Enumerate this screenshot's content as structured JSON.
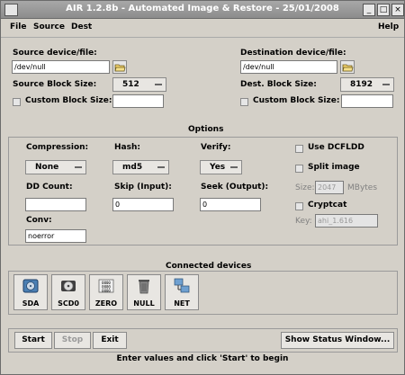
{
  "window": {
    "title": "AIR 1.2.8b - Automated Image & Restore - 25/01/2008"
  },
  "menu": {
    "file": "File",
    "source": "Source",
    "dest": "Dest",
    "help": "Help"
  },
  "source": {
    "label": "Source device/file:",
    "path": "/dev/null",
    "block_size_label": "Source Block Size:",
    "block_size": "512",
    "custom_label": "Custom Block Size:"
  },
  "dest": {
    "label": "Destination device/file:",
    "path": "/dev/null",
    "block_size_label": "Dest. Block Size:",
    "block_size": "8192",
    "custom_label": "Custom Block Size:"
  },
  "options": {
    "title": "Options",
    "compression_label": "Compression:",
    "compression": "None",
    "hash_label": "Hash:",
    "hash": "md5",
    "verify_label": "Verify:",
    "verify": "Yes",
    "use_dcfldd": "Use DCFLDD",
    "split_image": "Split image",
    "size_label": "Size:",
    "size_value": "2047",
    "size_unit": "MBytes",
    "cryptcat": "Cryptcat",
    "key_label": "Key:",
    "key_value": "ahi_1.616",
    "dd_count_label": "DD Count:",
    "dd_count": "",
    "skip_label": "Skip (Input):",
    "skip": "0",
    "seek_label": "Seek (Output):",
    "seek": "0",
    "conv_label": "Conv:",
    "conv": "noerror"
  },
  "devices": {
    "title": "Connected devices",
    "items": [
      {
        "label": "SDA",
        "icon": "hard-disk-icon"
      },
      {
        "label": "SCD0",
        "icon": "cd-drive-icon"
      },
      {
        "label": "ZERO",
        "icon": "zero-grid-icon"
      },
      {
        "label": "NULL",
        "icon": "trash-icon"
      },
      {
        "label": "NET",
        "icon": "network-icon"
      }
    ]
  },
  "actions": {
    "start": "Start",
    "stop": "Stop",
    "exit": "Exit",
    "status_window": "Show Status Window..."
  },
  "status_text": "Enter values and click 'Start' to begin"
}
